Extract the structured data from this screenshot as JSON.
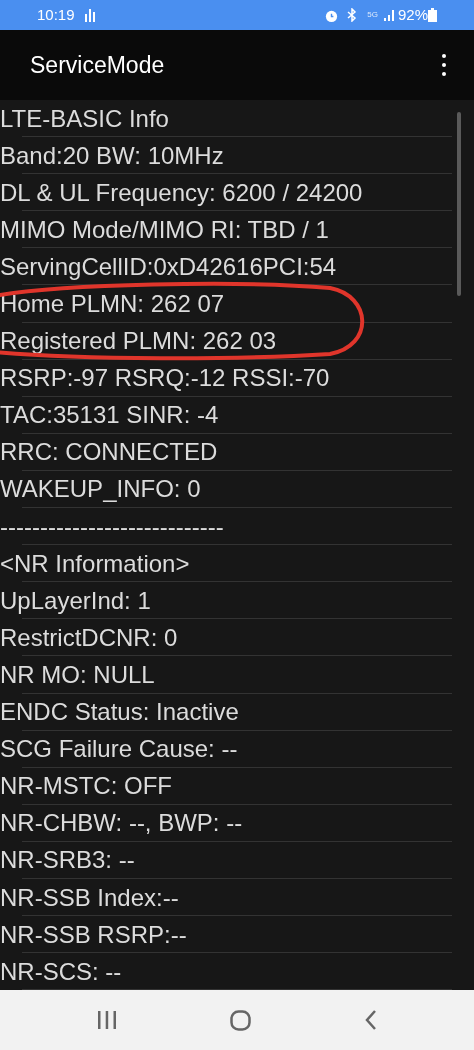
{
  "status_bar": {
    "time": "10:19",
    "network": "5G",
    "battery": "92%"
  },
  "app_bar": {
    "title": "ServiceMode"
  },
  "rows": [
    "LTE-BASIC Info",
    "Band:20 BW: 10MHz",
    "DL & UL Frequency: 6200 / 24200",
    "MIMO Mode/MIMO RI: TBD / 1",
    "ServingCellID:0xD42616PCI:54",
    "Home PLMN: 262 07",
    "Registered PLMN: 262 03",
    "RSRP:-97 RSRQ:-12 RSSI:-70",
    "TAC:35131 SINR: -4",
    "RRC: CONNECTED",
    "WAKEUP_INFO: 0",
    "----------------------------",
    "<NR Information>",
    "UpLayerInd: 1",
    "RestrictDCNR: 0",
    "NR MO: NULL",
    "ENDC Status: Inactive",
    "SCG Failure Cause: --",
    "NR-MSTC: OFF",
    "NR-CHBW: --, BWP: --",
    "NR-SRB3: --",
    "NR-SSB Index:--",
    "NR-SSB RSRP:--",
    "NR-SCS: --"
  ],
  "annotation": {
    "kind": "ellipse"
  }
}
